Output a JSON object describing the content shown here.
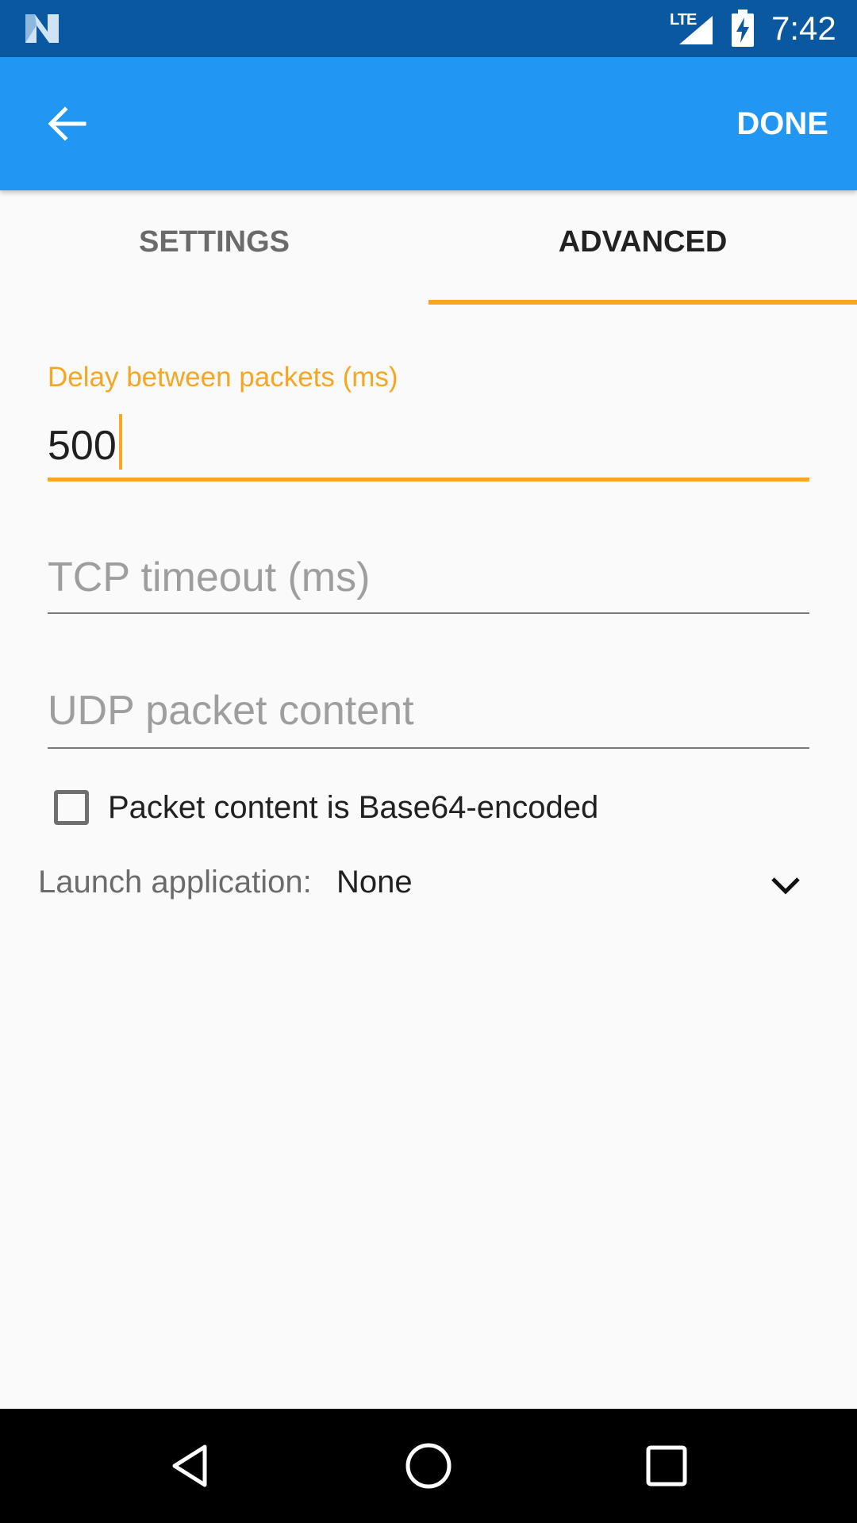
{
  "status_bar": {
    "network_label": "LTE",
    "time": "7:42",
    "icons": [
      "n-logo-icon",
      "signal-icon",
      "battery-charging-icon"
    ]
  },
  "app_bar": {
    "back_icon": "arrow-back-icon",
    "done_label": "DONE",
    "color": "#2196f3"
  },
  "tabs": [
    {
      "label": "SETTINGS",
      "selected": false
    },
    {
      "label": "ADVANCED",
      "selected": true
    }
  ],
  "accent_color": "#f5a623",
  "form": {
    "delay": {
      "label": "Delay between packets (ms)",
      "value": "500"
    },
    "tcp_timeout": {
      "placeholder": "TCP timeout (ms)",
      "value": ""
    },
    "udp_content": {
      "placeholder": "UDP packet content",
      "value": ""
    },
    "base64_checkbox": {
      "label": "Packet content is Base64-encoded",
      "checked": false
    },
    "launch_app": {
      "label": "Launch application:",
      "value": "None",
      "icon": "chevron-down-icon"
    }
  },
  "nav_bar": {
    "icons": [
      "back-triangle-icon",
      "home-circle-icon",
      "recents-square-icon"
    ]
  }
}
